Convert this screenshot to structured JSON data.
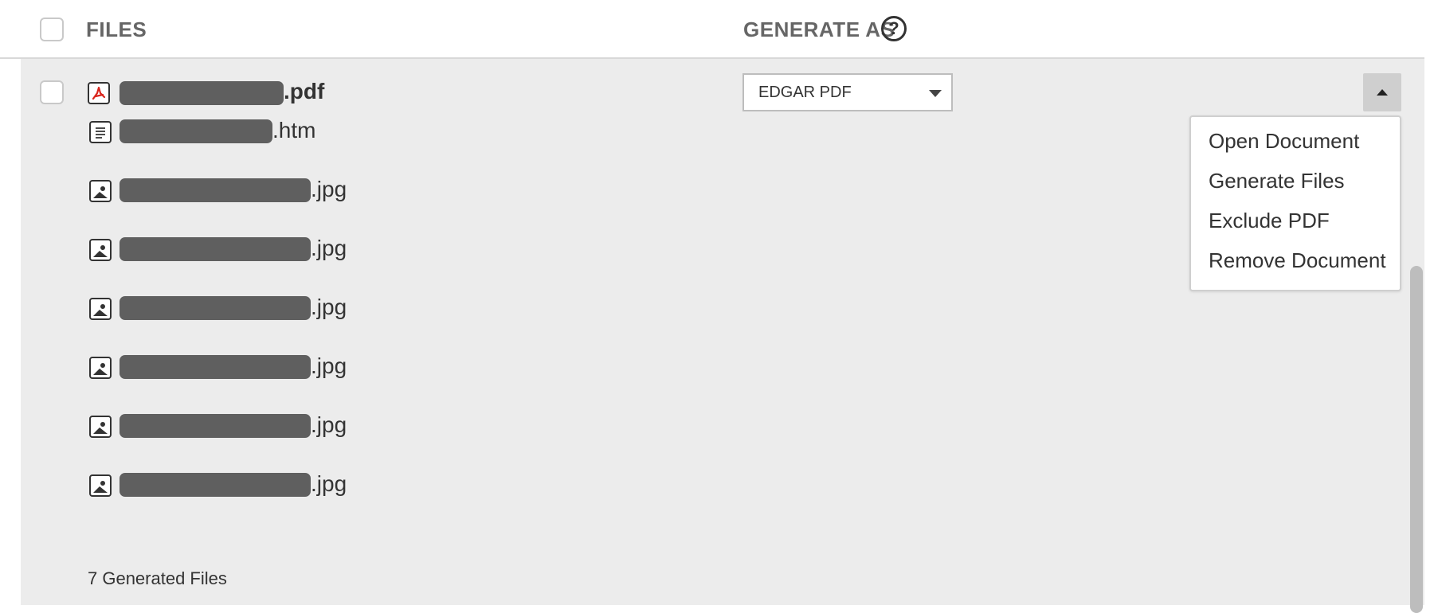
{
  "header": {
    "files_label": "FILES",
    "generate_as_label": "GENERATE AS",
    "help_glyph": "?"
  },
  "primary_file": {
    "extension": ".pdf",
    "icon": "pdf-icon",
    "generate_as_value": "EDGAR PDF"
  },
  "generated_files": [
    {
      "extension": ".htm",
      "icon": "document-icon"
    },
    {
      "extension": ".jpg",
      "icon": "image-icon"
    },
    {
      "extension": ".jpg",
      "icon": "image-icon"
    },
    {
      "extension": ".jpg",
      "icon": "image-icon"
    },
    {
      "extension": ".jpg",
      "icon": "image-icon"
    },
    {
      "extension": ".jpg",
      "icon": "image-icon"
    },
    {
      "extension": ".jpg",
      "icon": "image-icon"
    }
  ],
  "actions_menu": {
    "items": [
      "Open Document",
      "Generate Files",
      "Exclude PDF",
      "Remove Document"
    ]
  },
  "footer": {
    "generated_count_text": "7 Generated Files"
  },
  "colors": {
    "panel_bg": "#ececec",
    "redaction": "#5f5f5f",
    "pdf_accent": "#d9251d"
  }
}
